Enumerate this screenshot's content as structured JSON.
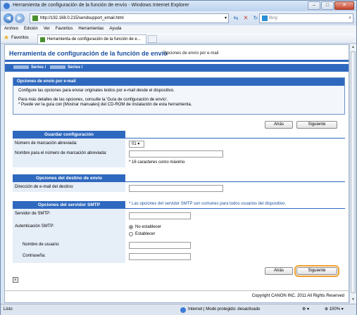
{
  "window": {
    "title": "Herramienta de configuración de la función de envío - Windows Internet Explorer",
    "min": "–",
    "max": "□",
    "close": "✕"
  },
  "address": {
    "url": "http://192.168.0.215/sendsupport_email.html",
    "search_placeholder": "Bing"
  },
  "menu": [
    "Archivo",
    "Edición",
    "Ver",
    "Favoritos",
    "Herramientas",
    "Ayuda"
  ],
  "favorites": {
    "label": "Favoritos",
    "tab_title": "Herramienta de configuración de la función de e..."
  },
  "page": {
    "title": "Herramienta de configuración de la función de envío",
    "subtitle": "Opciones de envío por e-mail",
    "series_label": "Series /",
    "series_label2": "Series /"
  },
  "info": {
    "heading": "Opciones de envío por e-mail",
    "line1": "Configure las opciones para enviar originales leídos por e-mail desde el dispositivo.",
    "line2": "Para más detalles de las opciones, consulte la 'Guía de configuración de envío'.",
    "line3": "* Puede ver la guía con [Mostrar manuales] del CD-ROM de instalación de esta herramienta."
  },
  "buttons": {
    "back": "Atrás",
    "next": "Siguiente"
  },
  "save_section": {
    "heading": "Guardar configuración",
    "abbr_number_label": "Número de marcación abreviada:",
    "abbr_number_value": "01",
    "abbr_name_label": "Nombre para el número de marcación abreviada:",
    "abbr_name_note": "* 16 caracteres como máximo"
  },
  "dest_section": {
    "heading": "Opciones del destino de envío",
    "email_label": "Dirección de e-mail del destino:"
  },
  "smtp_section": {
    "heading": "Opciones del servidor SMTP",
    "note": "* Las opciones del servidor SMTP son comunes para todos usuarios del dispositivo.",
    "server_label": "Servidor de SMTP:",
    "auth_label": "Autenticación SMTP:",
    "auth_option1": "No establecer",
    "auth_option2": "Establecer",
    "auth_selected": "No establecer",
    "user_label": "Nombre de usuario:",
    "password_label": "Contraseña:"
  },
  "footer": {
    "copyright": "Copyright CANON INC. 2011 All Rights Reserved"
  },
  "status": {
    "left": "Listo",
    "zone": "Internet | Modo protegido: desactivado",
    "zoom": "100%",
    "zoom_icon_label": "▾"
  },
  "colors": {
    "accent": "#2f69bf",
    "title_text": "#1a4f9f",
    "focus_ring": "#f0a030"
  }
}
